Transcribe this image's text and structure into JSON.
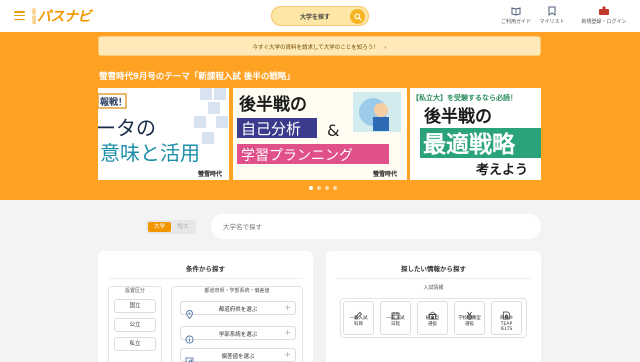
{
  "header": {
    "logo_small": "進学情報",
    "logo_main": "パスナビ",
    "search_label": "大学を探す",
    "links": [
      {
        "label": "ご利用ガイド",
        "icon": "book-icon"
      },
      {
        "label": "マイリスト",
        "icon": "bookmark-icon"
      },
      {
        "label": "新規登録・ログイン",
        "icon": "user-badge-icon",
        "badge": "まなびの"
      }
    ]
  },
  "hero": {
    "notice": "今すぐ大学の資料を請求して大学のことを知ろう！　›",
    "title": "螢雪時代9月号のテーマ「新課程入試 後半の戦略」",
    "slides": [
      {
        "tag": "報戦！",
        "line1": "ータの",
        "line2": "意味と活用",
        "footer": "螢雪時代"
      },
      {
        "line1": "後半戦の",
        "box1": "自己分析",
        "amp": "&",
        "box2": "学習プランニング",
        "footer": "螢雪時代"
      },
      {
        "top": "【私立大】を受験するなら必読！",
        "line1": "後半戦の",
        "line2": "最適戦略",
        "line3": "考えよう"
      }
    ],
    "dots": 4,
    "active_dot": 0
  },
  "search": {
    "tab_univ": "大学",
    "tab_dept": "短大",
    "placeholder": "大学名で探す"
  },
  "conditions": {
    "title": "条件から探す",
    "setup_label": "設置区分",
    "setup_items": [
      "国立",
      "公立",
      "私立"
    ],
    "area_label": "都道府県・学部系統・偏差値",
    "rows": [
      {
        "label": "都道府県を選ぶ",
        "icon": "map-pin-icon"
      },
      {
        "label": "学部系統を選ぶ",
        "icon": "info-circle-icon"
      },
      {
        "label": "偏差値を選ぶ",
        "icon": "bar-chart-icon"
      }
    ]
  },
  "info": {
    "title": "探したい情報から探す",
    "sub": "入試情報",
    "items": [
      {
        "label": "一般入試\n科目",
        "icon": "pencil-icon"
      },
      {
        "label": "一般入試\n日程",
        "icon": "calendar-icon"
      },
      {
        "label": "総合型\n選抜",
        "icon": "building-icon"
      },
      {
        "label": "学校推薦型\n選抜",
        "icon": "medal-icon"
      },
      {
        "label": "英検®\nTEAP\nIELTS",
        "icon": "document-a-icon"
      }
    ]
  },
  "colors": {
    "accent": "#f29600",
    "hero_bg": "#ffa223",
    "search_pill": "#fde6a6"
  }
}
